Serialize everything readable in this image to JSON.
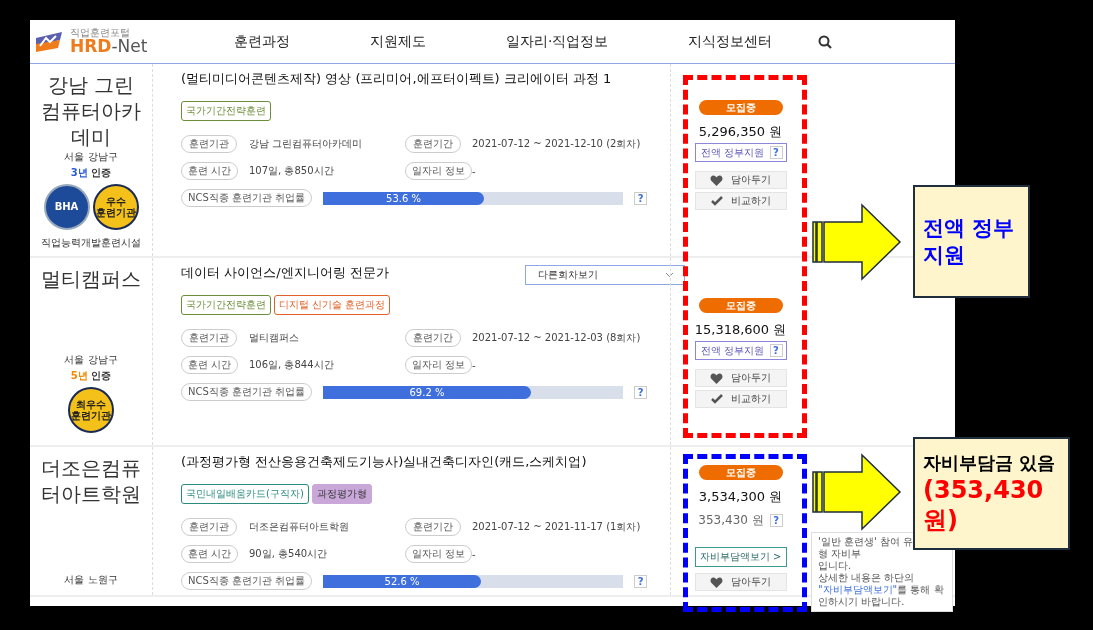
{
  "header": {
    "logo": {
      "tagline": "직업훈련포털",
      "brand_main": "HRD",
      "brand_suffix": "-Net"
    },
    "nav": [
      {
        "label": "훈련과정"
      },
      {
        "label": "지원제도"
      },
      {
        "label": "일자리·직업정보"
      },
      {
        "label": "지식정보센터"
      }
    ]
  },
  "courses": [
    {
      "institute": "강남 그린컴퓨터아카데미",
      "location": "서울 강남구",
      "certification": {
        "years": "3년",
        "label": "인증",
        "color": "#2a5bd7"
      },
      "badges": [
        {
          "kind": "bha",
          "text": "BHA"
        },
        {
          "kind": "gold",
          "text": "우수 훈련기관"
        }
      ],
      "facility": "직업능력개발훈련시설",
      "title": "(멀티미디어콘텐츠제작) 영상 (프리미어,에프터이펙트) 크리에이터 과정 1",
      "tags": [
        {
          "label": "국가기간전략훈련",
          "kind": "outline",
          "color": "#6b8e3a"
        }
      ],
      "info": [
        {
          "label": "훈련기관",
          "value": "강남 그린컴퓨터아카데미"
        },
        {
          "label": "훈련기간",
          "value": "2021-07-12 ~ 2021-12-10 (2회차)"
        },
        {
          "label": "훈련 시간",
          "value": "107일, 총850시간"
        },
        {
          "label": "일자리 정보",
          "value": "-"
        }
      ],
      "ncs": {
        "label": "NCS직종 훈련기관 취업률",
        "level": 0.536,
        "reading": "53.6 %",
        "help": "?"
      },
      "price": {
        "status": "모집중",
        "amount": "5,296,350 원",
        "support": {
          "label": "전액 정부지원",
          "help": "?"
        },
        "buttons": [
          {
            "kind": "save",
            "label": "담아두기"
          },
          {
            "kind": "compare",
            "label": "비교하기"
          }
        ]
      }
    },
    {
      "institute": "멀티캠퍼스",
      "location": "서울 강남구",
      "certification": {
        "years": "5년",
        "label": "인증",
        "color": "#f08a00"
      },
      "badges": [
        {
          "kind": "gold",
          "text": "최우수 훈련기관"
        }
      ],
      "title": "데이터 사이언스/엔지니어링 전문가",
      "dropdown": {
        "value": "다른회차보기"
      },
      "tags": [
        {
          "label": "국가기간전략훈련",
          "kind": "outline",
          "color": "#6b8e3a"
        },
        {
          "label": "디지털 신기술 훈련과정",
          "kind": "outline",
          "color": "#e0622a"
        }
      ],
      "info": [
        {
          "label": "훈련기관",
          "value": "멀티캠퍼스"
        },
        {
          "label": "훈련기간",
          "value": "2021-07-12 ~ 2021-12-03 (8회차)"
        },
        {
          "label": "훈련 시간",
          "value": "106일, 총844시간"
        },
        {
          "label": "일자리 정보",
          "value": "-"
        }
      ],
      "ncs": {
        "label": "NCS직종 훈련기관 취업률",
        "level": 0.692,
        "reading": "69.2 %",
        "help": "?"
      },
      "price": {
        "status": "모집중",
        "amount": "15,318,600 원",
        "support": {
          "label": "전액 정부지원",
          "help": "?"
        },
        "buttons": [
          {
            "kind": "save",
            "label": "담아두기"
          },
          {
            "kind": "compare",
            "label": "비교하기"
          }
        ]
      }
    },
    {
      "institute": "더조은컴퓨터아트학원",
      "location": "서울 노원구",
      "title": "(과정평가형 전산응용건축제도기능사)실내건축디자인(캐드,스케치업)",
      "tags": [
        {
          "label": "국민내일배움카드(구직자)",
          "kind": "outline",
          "color": "#2a8a80"
        },
        {
          "label": "과정평가형",
          "kind": "filled",
          "color": "#c9a7d9"
        }
      ],
      "info": [
        {
          "label": "훈련기관",
          "value": "더조은컴퓨터아트학원"
        },
        {
          "label": "훈련기간",
          "value": "2021-07-12 ~ 2021-11-17 (1회차)"
        },
        {
          "label": "훈련 시간",
          "value": "90일, 총540시간"
        },
        {
          "label": "일자리 정보",
          "value": "-"
        }
      ],
      "ncs": {
        "label": "NCS직종 훈련기관 취업률",
        "level": 0.526,
        "reading": "52.6 %",
        "help": "?"
      },
      "price": {
        "status": "모집중",
        "amount": "3,534,300 원",
        "self_pay": {
          "amount": "353,430 원",
          "help": "?"
        },
        "detail_button": "자비부담액보기 >",
        "buttons": [
          {
            "kind": "save",
            "label": "담아두기"
          }
        ]
      }
    }
  ],
  "tooltip": {
    "lines": [
      "'일반 훈련생' 참여 유형 자비부",
      "입니다."
    ],
    "before": "상세한 내용은 하단의 ",
    "link": "\"자비부담액보기\"",
    "after": "를 통해 확인하시기 바랍니다."
  },
  "annotations": [
    {
      "kind": "full",
      "color": "#ff0000",
      "lines": [
        {
          "text": "전액 정부지원",
          "color": "#0000ff"
        }
      ]
    },
    {
      "kind": "self",
      "color": "#0000ff",
      "lines": [
        {
          "text": "자비부담금 있음",
          "color": "#000000"
        },
        {
          "text": "(353,430원)",
          "color": "#ff0000"
        }
      ]
    }
  ]
}
